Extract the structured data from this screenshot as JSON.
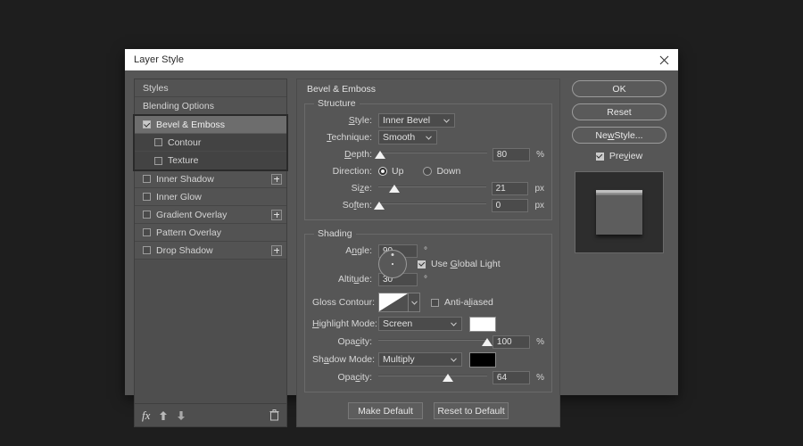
{
  "desktop": {
    "bg_color": "#1e1e1e"
  },
  "dialog": {
    "title": "Layer Style",
    "close_icon": "close-icon",
    "bg_color": "#565656",
    "titlebar_color": "#ffffff"
  },
  "sidebar": {
    "items": [
      {
        "label": "Styles",
        "type": "nav",
        "checkbox": null,
        "plus": false,
        "selected": false
      },
      {
        "label": "Blending Options",
        "type": "nav",
        "checkbox": null,
        "plus": false,
        "selected": false
      },
      {
        "label": "Bevel & Emboss",
        "type": "effect",
        "checkbox": true,
        "plus": false,
        "selected": true
      },
      {
        "label": "Contour",
        "type": "sub",
        "checkbox": false,
        "plus": false,
        "selected": false
      },
      {
        "label": "Texture",
        "type": "sub",
        "checkbox": false,
        "plus": false,
        "selected": false
      },
      {
        "label": "Inner Shadow",
        "type": "effect",
        "checkbox": false,
        "plus": true,
        "selected": false
      },
      {
        "label": "Inner Glow",
        "type": "effect",
        "checkbox": false,
        "plus": false,
        "selected": false
      },
      {
        "label": "Gradient Overlay",
        "type": "effect",
        "checkbox": false,
        "plus": true,
        "selected": false
      },
      {
        "label": "Pattern Overlay",
        "type": "effect",
        "checkbox": false,
        "plus": false,
        "selected": false
      },
      {
        "label": "Drop Shadow",
        "type": "effect",
        "checkbox": false,
        "plus": true,
        "selected": false
      }
    ],
    "toolbar": {
      "fx_label": "fx",
      "move_up_icon": "arrow-up-icon",
      "move_down_icon": "arrow-down-icon",
      "delete_icon": "trash-icon"
    }
  },
  "main": {
    "section_title": "Bevel & Emboss",
    "structure": {
      "legend": "Structure",
      "style": {
        "label": "Style:",
        "value": "Inner Bevel"
      },
      "technique": {
        "label": "Technique:",
        "value": "Smooth"
      },
      "depth": {
        "label": "Depth:",
        "value": "80",
        "unit": "%",
        "slider_pct": 2
      },
      "direction": {
        "label": "Direction:",
        "up_label": "Up",
        "down_label": "Down",
        "selected": "Up"
      },
      "size": {
        "label": "Size:",
        "value": "21",
        "unit": "px",
        "slider_pct": 15
      },
      "soften": {
        "label": "Soften:",
        "value": "0",
        "unit": "px",
        "slider_pct": 1
      }
    },
    "shading": {
      "legend": "Shading",
      "angle": {
        "label": "Angle:",
        "value": "90",
        "unit": "°"
      },
      "use_global_light": {
        "label": "Use Global Light",
        "checked": true
      },
      "altitude": {
        "label": "Altitude:",
        "value": "30",
        "unit": "°"
      },
      "gloss_contour": {
        "label": "Gloss Contour:",
        "swatch": "linear-contour-swatch"
      },
      "anti_aliased": {
        "label": "Anti-aliased",
        "checked": false
      },
      "highlight_mode": {
        "label": "Highlight Mode:",
        "value": "Screen",
        "color": "#ffffff",
        "opacity": {
          "label": "Opacity:",
          "value": "100",
          "unit": "%",
          "slider_pct": 100
        }
      },
      "shadow_mode": {
        "label": "Shadow Mode:",
        "value": "Multiply",
        "color": "#000000",
        "opacity": {
          "label": "Opacity:",
          "value": "64",
          "unit": "%",
          "slider_pct": 64
        }
      }
    },
    "buttons": {
      "make_default": "Make Default",
      "reset_to_default": "Reset to Default"
    }
  },
  "right_panel": {
    "ok": "OK",
    "reset": "Reset",
    "new_style": "New Style...",
    "preview": {
      "label": "Preview",
      "checked": true
    },
    "thumbnail": "bevel-preview-thumbnail"
  }
}
